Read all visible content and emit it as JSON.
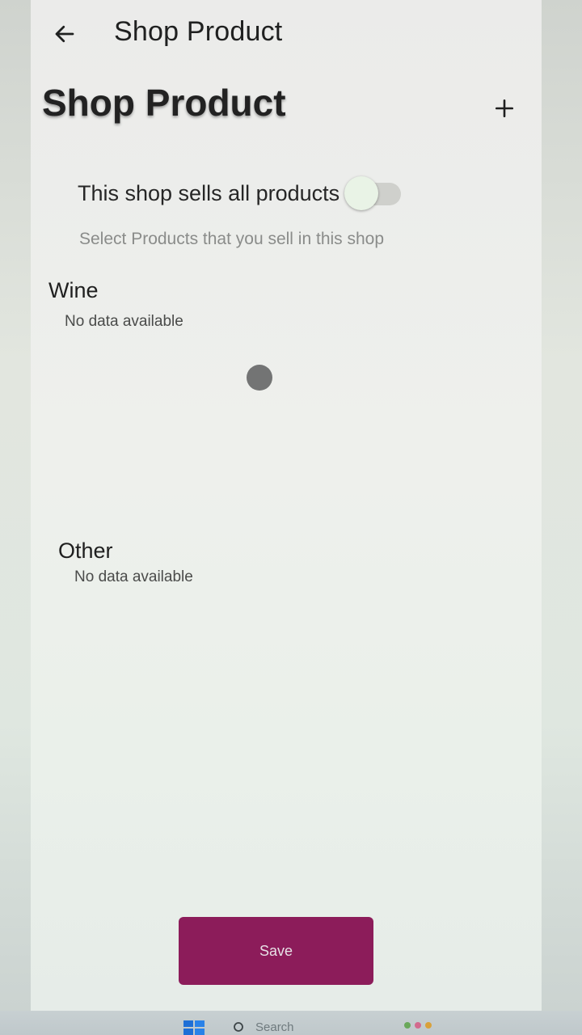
{
  "appbar": {
    "title": "Shop Product"
  },
  "header": {
    "title": "Shop Product",
    "add_icon": "plus-icon"
  },
  "settings": {
    "sells_all_label": "This shop sells all products",
    "sells_all_enabled": false,
    "helper_text": "Select Products that you sell in this shop"
  },
  "sections": [
    {
      "title": "Wine",
      "empty_text": "No data available"
    },
    {
      "title": "Other",
      "empty_text": "No data available"
    }
  ],
  "actions": {
    "save_label": "Save"
  },
  "taskbar": {
    "search_placeholder": "Search"
  },
  "colors": {
    "accent": "#8c1c5a",
    "background": "#eceeeb",
    "helper_text": "#8a8c8a"
  }
}
